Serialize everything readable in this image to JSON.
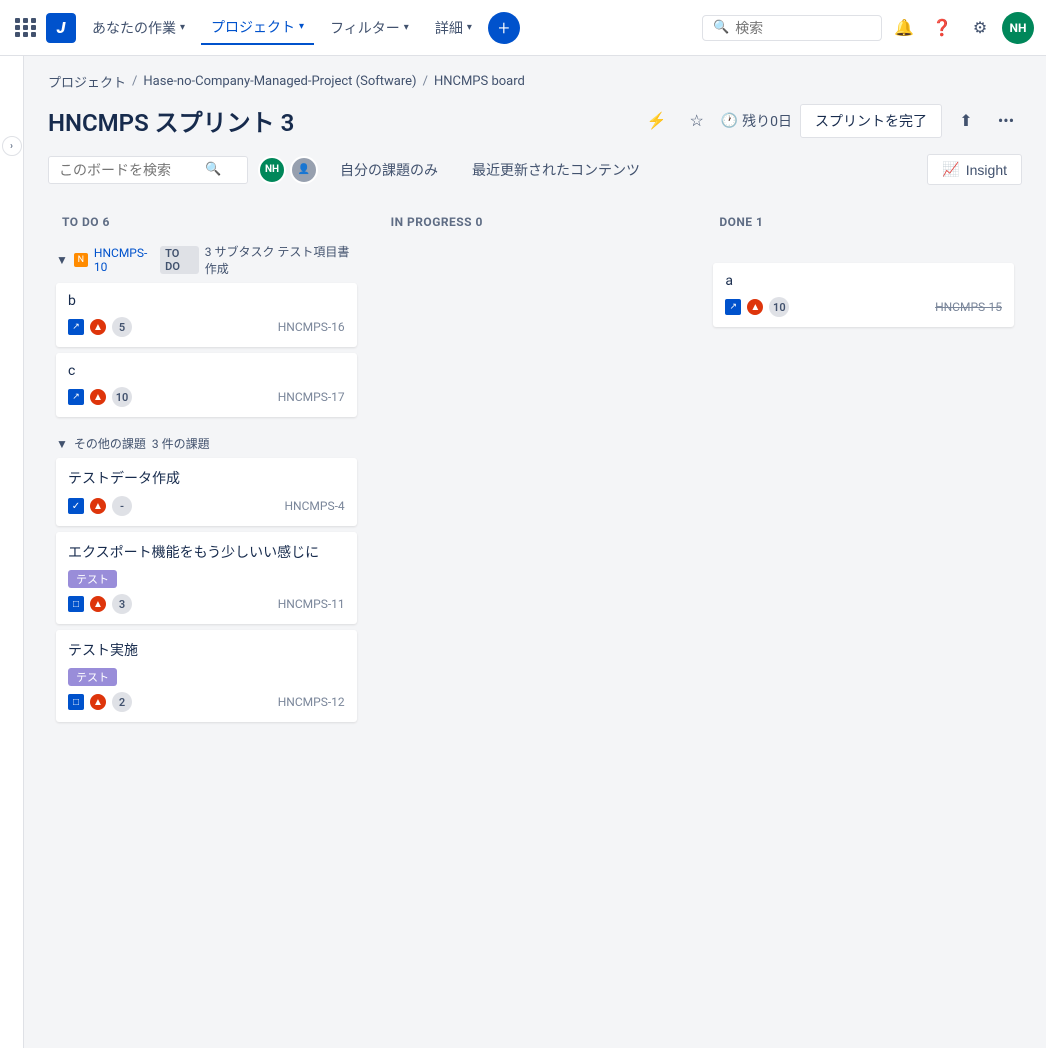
{
  "topnav": {
    "my_work_label": "あなたの作業",
    "projects_label": "プロジェクト",
    "filters_label": "フィルター",
    "details_label": "詳細",
    "search_placeholder": "検索",
    "user_initials": "NH"
  },
  "breadcrumb": {
    "project": "プロジェクト",
    "project_name": "Hase-no-Company-Managed-Project (Software)",
    "board": "HNCMPS board"
  },
  "page": {
    "title": "HNCMPS スプリント 3",
    "days_remaining": "残り0日",
    "sprint_complete_label": "スプリントを完了"
  },
  "toolbar": {
    "search_placeholder": "このボードを検索",
    "my_issues_label": "自分の課題のみ",
    "recent_content_label": "最近更新されたコンテンツ",
    "insight_label": "Insight",
    "user_initials": "NH"
  },
  "columns": [
    {
      "id": "todo",
      "header": "TO DO",
      "count": 6
    },
    {
      "id": "inprogress",
      "header": "IN PROGRESS",
      "count": 0
    },
    {
      "id": "done",
      "header": "DONE",
      "count": 1
    }
  ],
  "epic_group": {
    "arrow": "▼",
    "epic_label": "HNCMPS-10",
    "todo_badge": "TO DO",
    "subtask_text": "3 サブタスク テスト項目書作成",
    "cards": [
      {
        "title": "b",
        "type_icon": "↗",
        "priority": "▲",
        "points": 5,
        "id": "HNCMPS-16",
        "strikethrough": false
      },
      {
        "title": "c",
        "type_icon": "↗",
        "priority": "▲",
        "points": 10,
        "id": "HNCMPS-17",
        "strikethrough": false
      }
    ],
    "done_cards": [
      {
        "title": "a",
        "type_icon": "↗",
        "priority": "▲",
        "points": 10,
        "id": "HNCMPS-15",
        "strikethrough": true
      }
    ]
  },
  "other_group": {
    "arrow": "▼",
    "label": "その他の課題",
    "count_label": "3 件の課題",
    "cards": [
      {
        "title": "テストデータ作成",
        "type_icon": "✓",
        "priority": "▲",
        "points": "-",
        "id": "HNCMPS-4",
        "tag": null
      },
      {
        "title": "エクスポート機能をもう少しいい感じに",
        "type_icon": "□",
        "priority": "▲",
        "points": 3,
        "id": "HNCMPS-11",
        "tag": "テスト"
      },
      {
        "title": "テスト実施",
        "type_icon": "□",
        "priority": "▲",
        "points": 2,
        "id": "HNCMPS-12",
        "tag": "テスト"
      }
    ]
  }
}
